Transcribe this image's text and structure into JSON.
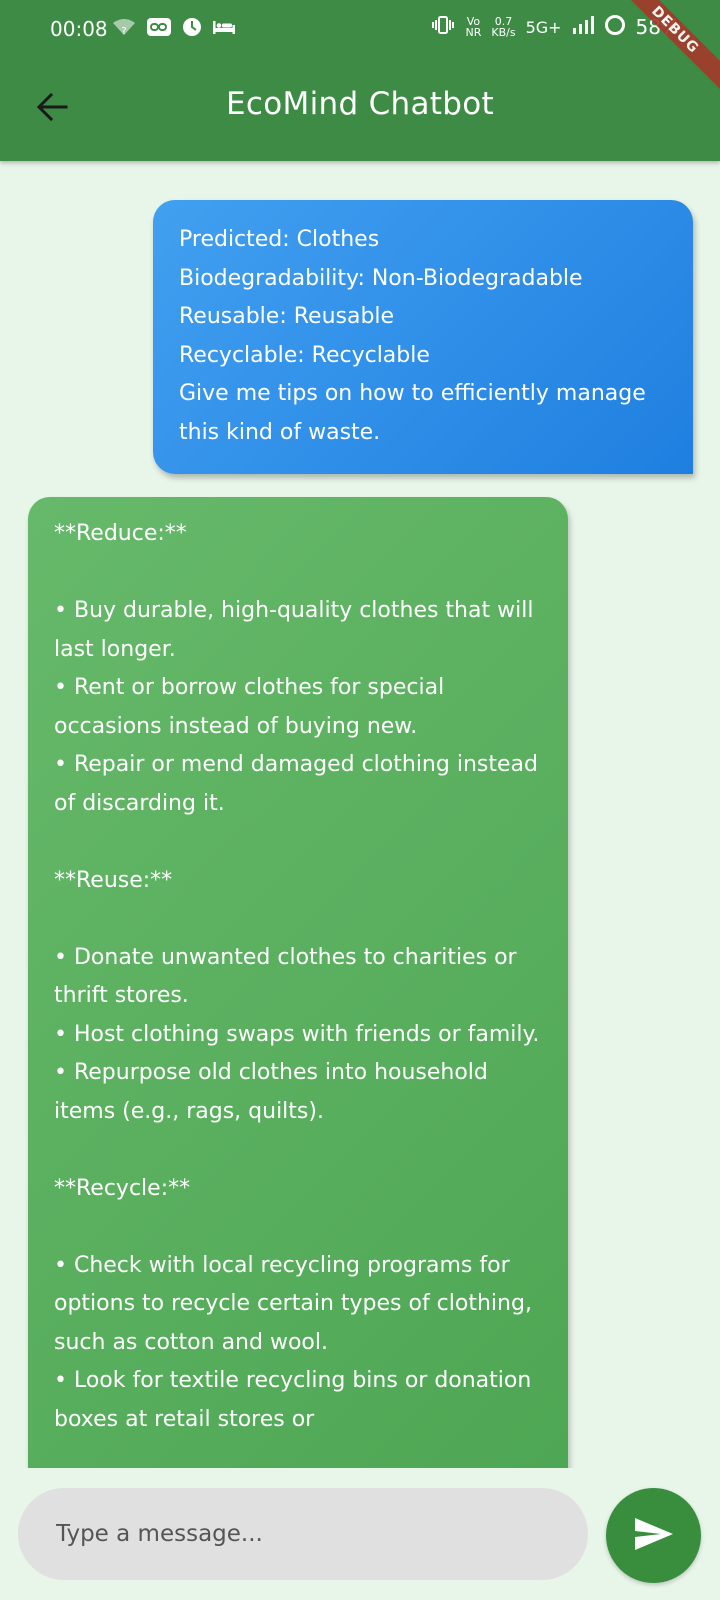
{
  "status_bar": {
    "time": "00:08",
    "speed_value": "0.7",
    "speed_unit": "KB/s",
    "volte_top": "Vo",
    "volte_bottom": "NR",
    "network": "5G+",
    "battery": "58%",
    "debug_label": "DEBUG"
  },
  "header": {
    "title": "EcoMind Chatbot",
    "back_icon": "arrow-back-icon",
    "color": "#3d8b45"
  },
  "messages": [
    {
      "sender": "user",
      "text": "Predicted: Clothes\nBiodegradability: Non-Biodegradable\nReusable: Reusable\nRecyclable: Recyclable\nGive me tips on how to efficiently manage this kind of waste."
    },
    {
      "sender": "bot",
      "text": "**Reduce:**\n\n• Buy durable, high-quality clothes that will last longer.\n• Rent or borrow clothes for special occasions instead of buying new.\n• Repair or mend damaged clothing instead of discarding it.\n\n**Reuse:**\n\n• Donate unwanted clothes to charities or thrift stores.\n• Host clothing swaps with friends or family.\n• Repurpose old clothes into household items (e.g., rags, quilts).\n\n**Recycle:**\n\n• Check with local recycling programs for options to recycle certain types of clothing, such as cotton and wool.\n• Look for textile recycling bins or donation boxes at retail stores or"
    }
  ],
  "composer": {
    "placeholder": "Type a message...",
    "send_icon": "send-icon"
  },
  "colors": {
    "background": "#e8f5e9",
    "user_bubble": "#2f8ee8",
    "bot_bubble": "#5aaf5e",
    "send_button": "#388e3c"
  }
}
